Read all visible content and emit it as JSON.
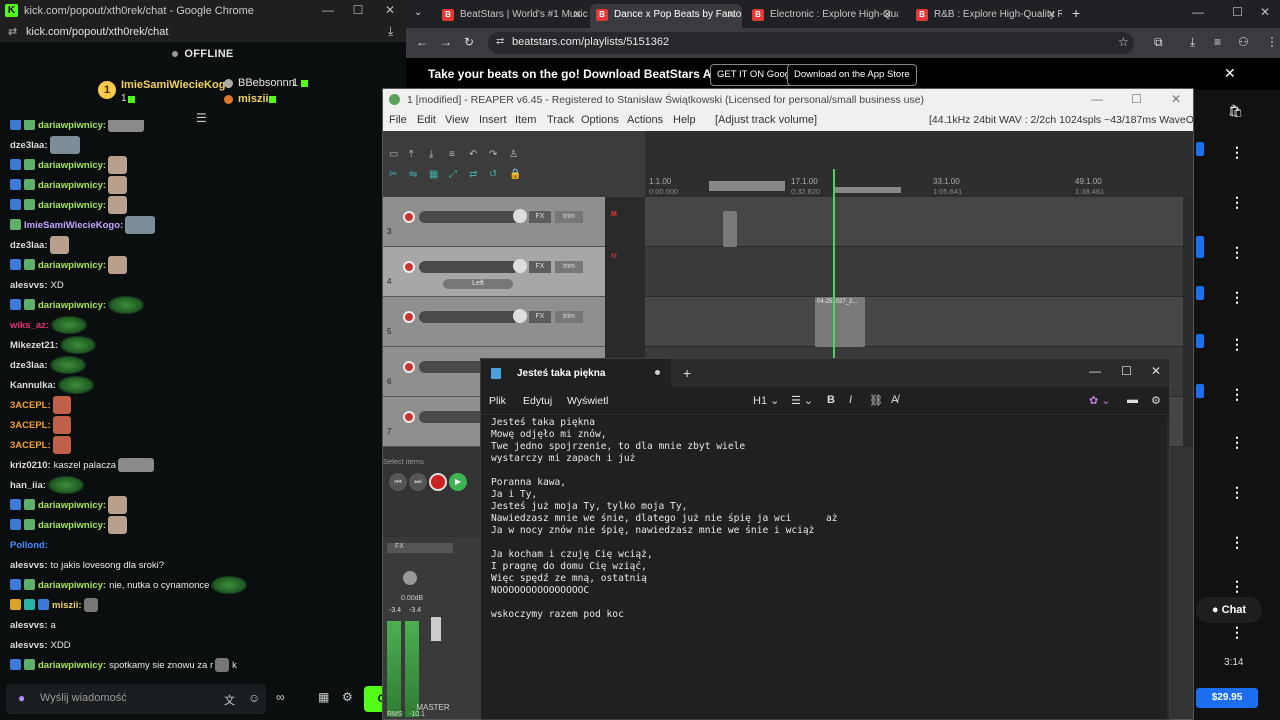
{
  "kick": {
    "window_title": "kick.com/popout/xth0rek/chat - Google Chrome",
    "url": "kick.com/popout/xth0rek/chat",
    "status": "OFFLINE",
    "gifters": {
      "top_name": "ImieSamiWiecieKogo",
      "top_rank": "1",
      "top_count": "1",
      "second_name": "BBebsonnn",
      "second_count": "1",
      "third_name": "miszii"
    },
    "messages": [
      {
        "user": "dariawpiwnicy:",
        "color": "#a6e35a",
        "text": "",
        "emote": "e-cat",
        "badges": [
          "b-blue",
          "b-green"
        ]
      },
      {
        "user": "dze3laa:",
        "color": "#dddddd",
        "text": "",
        "emote": "e-pic",
        "badges": []
      },
      {
        "user": "dariawpiwnicy:",
        "color": "#a6e35a",
        "text": "",
        "emote": "e-face",
        "badges": [
          "b-blue",
          "b-green"
        ]
      },
      {
        "user": "dariawpiwnicy:",
        "color": "#a6e35a",
        "text": "",
        "emote": "e-face",
        "badges": [
          "b-blue",
          "b-green"
        ]
      },
      {
        "user": "dariawpiwnicy:",
        "color": "#a6e35a",
        "text": "",
        "emote": "e-face",
        "badges": [
          "b-blue",
          "b-green"
        ]
      },
      {
        "user": "ImieSamiWiecieKogo:",
        "color": "#c7a3ff",
        "text": "",
        "emote": "e-pic",
        "badges": [
          "b-green"
        ]
      },
      {
        "user": "dze3laa:",
        "color": "#dddddd",
        "text": "",
        "emote": "e-face",
        "badges": []
      },
      {
        "user": "dariawpiwnicy:",
        "color": "#a6e35a",
        "text": "",
        "emote": "e-face",
        "badges": [
          "b-blue",
          "b-green"
        ]
      },
      {
        "user": "alesvvs:",
        "color": "#dddddd",
        "text": "XD",
        "emote": "",
        "badges": []
      },
      {
        "user": "dariawpiwnicy:",
        "color": "#a6e35a",
        "text": "",
        "emote": "e-green",
        "badges": [
          "b-blue",
          "b-green"
        ]
      },
      {
        "user": "wiks_az:",
        "color": "#e0327a",
        "text": "",
        "emote": "e-green",
        "badges": []
      },
      {
        "user": "Mikezet21:",
        "color": "#dddddd",
        "text": "",
        "emote": "e-green",
        "badges": []
      },
      {
        "user": "dze3laa:",
        "color": "#dddddd",
        "text": "",
        "emote": "e-green",
        "badges": []
      },
      {
        "user": "Kannulka:",
        "color": "#dddddd",
        "text": "",
        "emote": "e-green",
        "badges": []
      },
      {
        "user": "3ACEPL:",
        "color": "#f0a030",
        "text": "",
        "emote": "e-red",
        "badges": []
      },
      {
        "user": "3ACEPL:",
        "color": "#f0a030",
        "text": "",
        "emote": "e-red",
        "badges": []
      },
      {
        "user": "3ACEPL:",
        "color": "#f0a030",
        "text": "",
        "emote": "e-red",
        "badges": []
      },
      {
        "user": "kriz0210:",
        "color": "#dddddd",
        "text": "kaszel palacza",
        "emote": "e-cat",
        "badges": []
      },
      {
        "user": "han_iia:",
        "color": "#dddddd",
        "text": "",
        "emote": "e-green",
        "badges": []
      },
      {
        "user": "dariawpiwnicy:",
        "color": "#a6e35a",
        "text": "",
        "emote": "e-face",
        "badges": [
          "b-blue",
          "b-green"
        ]
      },
      {
        "user": "dariawpiwnicy:",
        "color": "#a6e35a",
        "text": "",
        "emote": "e-face",
        "badges": [
          "b-blue",
          "b-green"
        ]
      },
      {
        "user": "Pollond:",
        "color": "#3d8bff",
        "text": "",
        "emote": "",
        "badges": []
      },
      {
        "user": "alesvvs:",
        "color": "#dddddd",
        "text": "to jakis lovesong dla sroki?",
        "emote": "",
        "badges": []
      },
      {
        "user": "dariawpiwnicy:",
        "color": "#a6e35a",
        "text": "nie, nutka o cynamonce",
        "emote": "e-green",
        "badges": [
          "b-blue",
          "b-green"
        ]
      },
      {
        "user": "miszii:",
        "color": "#f0d060",
        "text": "",
        "emote": "e-small",
        "badges": [
          "b-gold",
          "b-teal",
          "b-blue"
        ]
      },
      {
        "user": "alesvvs:",
        "color": "#dddddd",
        "text": "a",
        "emote": "",
        "badges": []
      },
      {
        "user": "alesvvs:",
        "color": "#dddddd",
        "text": "XDD",
        "emote": "",
        "badges": []
      },
      {
        "user": "dariawpiwnicy:",
        "color": "#a6e35a",
        "text": "spotkamy sie znowu za r",
        "emote": "e-small",
        "suffix": "k",
        "badges": [
          "b-blue",
          "b-green"
        ]
      }
    ],
    "input_placeholder": "Wyślij wiadomość",
    "chat_button": "Ch"
  },
  "browser": {
    "tabs": [
      {
        "label": "BeatStars | World's #1 Music M",
        "active": false,
        "color": "#e53935"
      },
      {
        "label": "Dance x Pop Beats by Fantom",
        "active": true,
        "color": "#e53935"
      },
      {
        "label": "Electronic : Explore High-Qualit",
        "active": false,
        "color": "#e53935"
      },
      {
        "label": "R&B : Explore High-Quality R&",
        "active": false,
        "color": "#e53935"
      }
    ],
    "url": "beatstars.com/playlists/5151362",
    "banner_text": "Take your beats on the go! Download BeatStars App",
    "google_play": "GET IT ON Google Play",
    "app_store": "Download on the App Store",
    "chat_label": "Chat",
    "duration": "3:14",
    "price": "$29.95"
  },
  "reaper": {
    "title": "1 [modified] - REAPER v6.45 - Registered to Stanisław Świątkowski (Licensed for personal/small business use)",
    "menu": [
      "File",
      "Edit",
      "View",
      "Insert",
      "Item",
      "Track",
      "Options",
      "Actions",
      "Help",
      "[Adjust track volume]"
    ],
    "format": "[44.1kHz 24bit WAV : 2/2ch 1024spls ~43/187ms WaveOut]",
    "ruler": [
      {
        "bar": "1.1.00",
        "time": "0:00.000"
      },
      {
        "bar": "17.1.00",
        "time": "0:32.820"
      },
      {
        "bar": "33.1.00",
        "time": "1:05.641"
      },
      {
        "bar": "49.1.00",
        "time": "1:38.461"
      }
    ],
    "tracks": [
      "3",
      "4",
      "5",
      "6",
      "7"
    ],
    "pan_label": "Left",
    "item_label": "04-251027_2...",
    "status": "Select items",
    "master_label": "MASTER",
    "master_levels": [
      "-3.4",
      "-3.4"
    ],
    "rms_label": "RMS",
    "rms_value": "-10.1",
    "db_label": "0.00dB"
  },
  "notepad": {
    "tab_title": "Jesteś taka piękna",
    "menu": [
      "Plik",
      "Edytuj",
      "Wyświetl"
    ],
    "heading_level": "H1",
    "content": "Jesteś taka piękna\nMowę odjęło mi znów,\nTwe jedno spojrzenie, to dla mnie zbyt wiele\nwystarczy mi zapach i już\n\nPoranna kawa,\nJa i Ty,\nJesteś już moja Ty, tylko moja Ty,\nNawiedzasz mnie we śnie, dlatego już nie śpię ja wci      aż\nJa w nocy znów nie śpię, nawiedzasz mnie we śnie i wciąż\n\nJa kocham i czuję Cię wciąż,\nI pragnę do domu Cię wziąć,\nWięc spędź ze mną, ostatnią\nNOOOOOOOOOOOOOOOC\n\nwskoczymy razem pod koc"
  }
}
